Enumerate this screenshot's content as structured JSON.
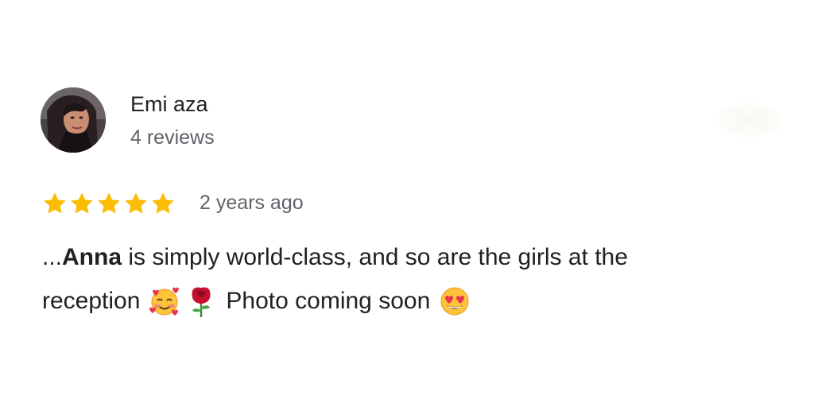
{
  "reviewer": {
    "name": "Emi aza",
    "review_count": "4 reviews",
    "avatar_icon": "profile-photo-avatar"
  },
  "rating": {
    "stars": 5,
    "max_stars": 5,
    "star_icon": "star-icon",
    "star_color": "#fbbc04",
    "time_ago": "2 years ago"
  },
  "review": {
    "line1_prefix": "...",
    "line1_name": "Anna",
    "line1_rest": " is simply world-class, and so are the girls at the",
    "line2_text1": "reception",
    "emoji1": "smiling-face-with-hearts-icon",
    "emoji2": "rose-icon",
    "line2_text2": "Photo coming soon",
    "emoji3": "heart-eyes-face-icon"
  },
  "colors": {
    "primary_text": "#202124",
    "secondary_text": "#5f6368",
    "background": "#ffffff"
  }
}
